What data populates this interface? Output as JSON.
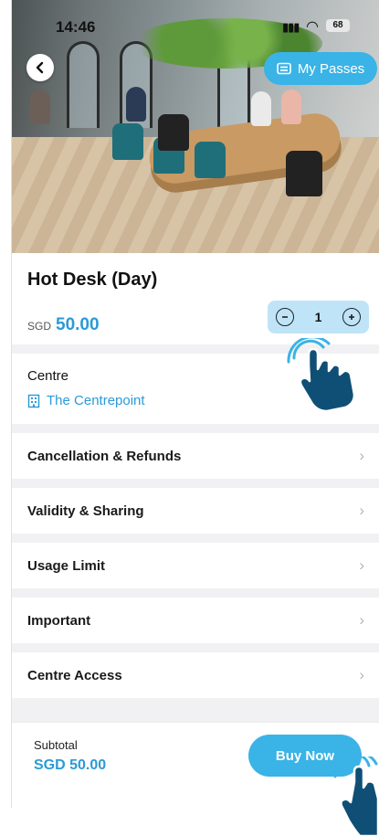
{
  "status_bar": {
    "time": "14:46",
    "battery": "68"
  },
  "hero": {
    "my_passes_label": "My Passes"
  },
  "product": {
    "title": "Hot Desk (Day)",
    "currency": "SGD",
    "price": "50.00",
    "quantity": "1"
  },
  "centre": {
    "label": "Centre",
    "name": "The Centrepoint"
  },
  "sections": [
    {
      "label": "Cancellation & Refunds"
    },
    {
      "label": "Validity & Sharing"
    },
    {
      "label": "Usage Limit"
    },
    {
      "label": "Important"
    },
    {
      "label": "Centre Access"
    }
  ],
  "footer": {
    "subtotal_label": "Subtotal",
    "subtotal_value": "SGD 50.00",
    "buy_label": "Buy Now"
  },
  "colors": {
    "accent": "#3ab3e6",
    "price_blue": "#2b9ad6",
    "stepper_bg": "#bfe4f7",
    "tap_hand": "#0f4f75"
  }
}
